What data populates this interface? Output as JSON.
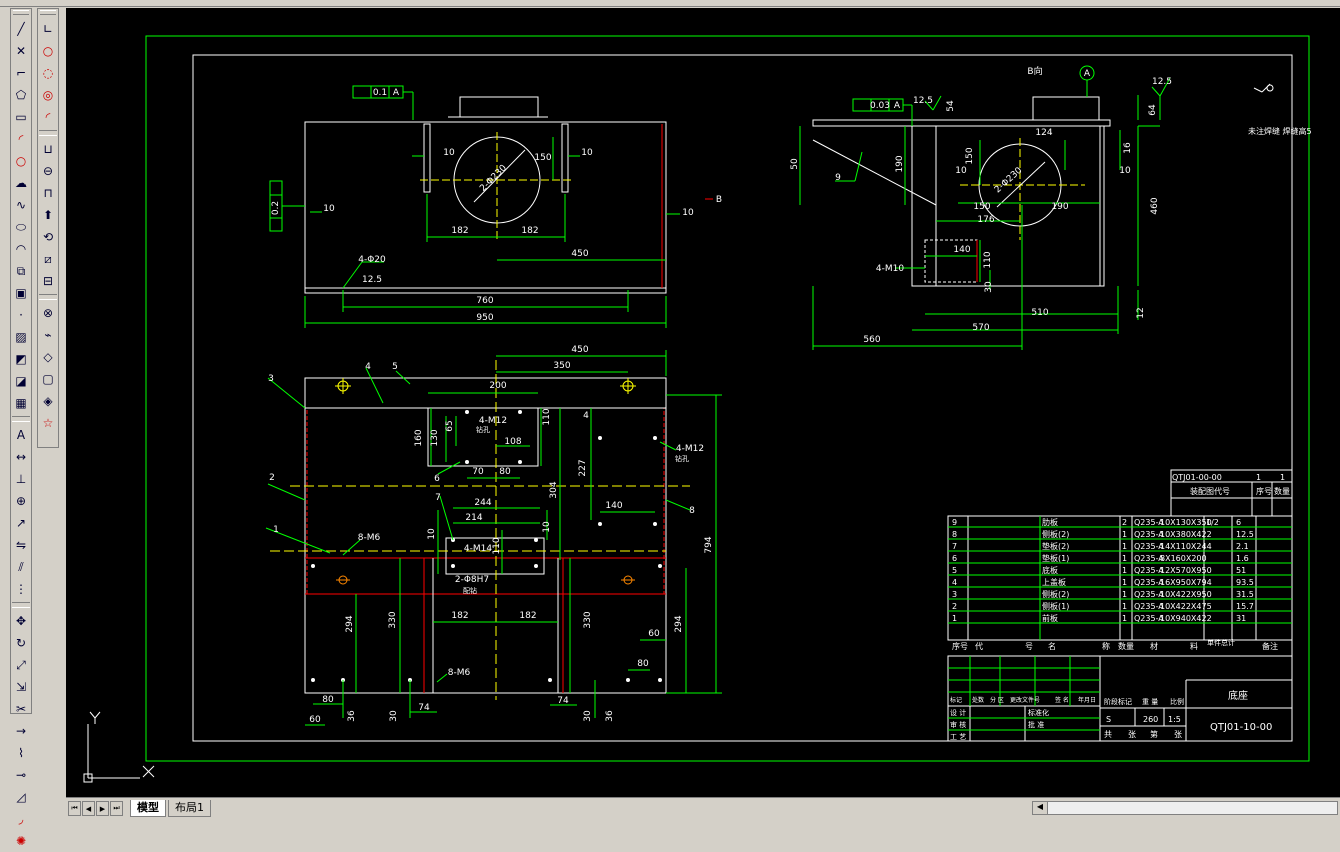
{
  "tabs": [
    {
      "label": "模型",
      "active": true
    },
    {
      "label": "布局1",
      "active": false
    }
  ],
  "toolbar_left": [
    "line-icon",
    "construction-line-icon",
    "polyline-icon",
    "polygon-icon",
    "rectangle-icon",
    "arc-icon",
    "circle-icon",
    "revcloud-icon",
    "spline-icon",
    "ellipse-icon",
    "ellipse-arc-icon",
    "insert-block-icon",
    "make-block-icon",
    "point-icon",
    "hatch-icon",
    "gradient-icon",
    "region-icon",
    "table-icon",
    "mtext-icon",
    "dimension-icon",
    "tolerance-icon",
    "center-mark-icon",
    "leader-icon",
    "mirror-icon",
    "offset-icon",
    "array-icon",
    "move-icon",
    "rotate-icon",
    "scale-icon",
    "stretch-icon",
    "trim-icon",
    "extend-icon",
    "break-icon",
    "join-icon",
    "chamfer-icon",
    "fillet-icon",
    "explode-icon"
  ],
  "toolbar_right": [
    "ucs-icon",
    "circle-icon",
    "circle-3p-icon",
    "circle-ttr-icon",
    "arc-icon",
    "union-icon",
    "subtract-icon",
    "intersect-icon",
    "extrude-icon",
    "revolve-icon",
    "slice-icon",
    "section-icon",
    "interfere-icon",
    "edge-icon",
    "face-icon",
    "shell-icon",
    "imprint-icon",
    "star-icon"
  ],
  "drawing": {
    "front_view": {
      "geom_tol": "0.1",
      "geom_tol_ref": "A",
      "perp_tol": "0.2",
      "perp_tol_ref": "A",
      "dims": {
        "d10a": "10",
        "d10b": "10",
        "d10c": "10",
        "d10d": "10",
        "d150": "150",
        "d182a": "182",
        "d182b": "182",
        "d450": "450",
        "d760": "760",
        "d950": "950",
        "d10e": "10"
      },
      "diameter": "2-Φ230",
      "holes": "4-Φ20",
      "rough": "12.5",
      "section": "B"
    },
    "side_view": {
      "parallel_tol": "0.03",
      "parallel_ref": "A",
      "rough_a": "12.5",
      "rough_b": "12.5",
      "datum": "A",
      "section": "B向",
      "dims": {
        "d54": "54",
        "d64": "64",
        "d124": "124",
        "d16": "16",
        "d50": "50",
        "d190a": "190",
        "d150a": "150",
        "d10a": "10",
        "d10b": "10",
        "d150b": "150",
        "d190b": "190",
        "d176": "176",
        "d460": "460",
        "d140": "140",
        "d110": "110",
        "d30": "30",
        "d510": "510",
        "d570": "570",
        "d560": "560",
        "d12": "12"
      },
      "diameter": "2-Φ230",
      "thread": "4-M10",
      "balloon": "9"
    },
    "note": "未注焊缝 焊缝高5",
    "plan_view": {
      "dims": {
        "d450": "450",
        "d350": "350",
        "d200": "200",
        "d110": "110",
        "d4": "4",
        "d160": "160",
        "d130": "130",
        "d65": "65",
        "d108": "108",
        "d227": "227",
        "d304": "304",
        "d70": "70",
        "d80": "80",
        "d140": "140",
        "d244": "244",
        "d214": "214",
        "d10a": "10",
        "d10b": "10",
        "d110b": "110",
        "d794": "794",
        "d330a": "330",
        "d330b": "330",
        "d182a": "182",
        "d182b": "182",
        "d294a": "294",
        "d294b": "294",
        "d60a": "60",
        "d80b": "80",
        "d80c": "80",
        "d60b": "60",
        "d36a": "36",
        "d30": "30",
        "d74a": "74",
        "d74b": "74",
        "d30b": "30",
        "d36b": "36"
      },
      "threads": {
        "t1": "4-M12",
        "t2": "4-M12",
        "t3": "8-M6",
        "t4": "4-M14",
        "t5": "8-M6"
      },
      "pin": "2-Φ8H7",
      "pin_note": "配钻",
      "thread_note_a": "钻孔",
      "thread_note_b": "钻孔",
      "balloons": [
        "1",
        "2",
        "3",
        "4",
        "5",
        "6",
        "7",
        "8"
      ]
    },
    "title_block": {
      "drawing_no_top": "QTJ01-00-00",
      "top_cells": [
        "1",
        "1"
      ],
      "top_headers": [
        "装配图代号",
        "序号",
        "数量"
      ],
      "bom": [
        {
          "no": "9",
          "name": "肋板",
          "qty": "2",
          "mat": "Q235-A",
          "spec": "10X130X350",
          "w": "1/2",
          "total": "6"
        },
        {
          "no": "8",
          "name": "侧板(2)",
          "qty": "1",
          "mat": "Q235-A",
          "spec": "10X380X422",
          "w": "",
          "total": "12.5"
        },
        {
          "no": "7",
          "name": "垫板(2)",
          "qty": "1",
          "mat": "Q235-A",
          "spec": "14X110X244",
          "w": "",
          "total": "2.1"
        },
        {
          "no": "6",
          "name": "垫板(1)",
          "qty": "1",
          "mat": "Q235-A",
          "spec": "8X160X200",
          "w": "",
          "total": "1.6"
        },
        {
          "no": "5",
          "name": "底板",
          "qty": "1",
          "mat": "Q235-A",
          "spec": "12X570X950",
          "w": "",
          "total": "51"
        },
        {
          "no": "4",
          "name": "上盖板",
          "qty": "1",
          "mat": "Q235-A",
          "spec": "16X950X794",
          "w": "",
          "total": "93.5"
        },
        {
          "no": "3",
          "name": "侧板(2)",
          "qty": "1",
          "mat": "Q235-A",
          "spec": "10X422X950",
          "w": "",
          "total": "31.5"
        },
        {
          "no": "2",
          "name": "侧板(1)",
          "qty": "1",
          "mat": "Q235-A",
          "spec": "10X422X475",
          "w": "",
          "total": "15.7"
        },
        {
          "no": "1",
          "name": "前板",
          "qty": "1",
          "mat": "Q235-A",
          "spec": "10X940X422",
          "w": "",
          "total": "31"
        }
      ],
      "header_row": [
        "序号",
        "代",
        "号",
        "名",
        "称",
        "数量",
        "材",
        "料",
        "单件总计",
        "备注"
      ],
      "part_name": "底座",
      "drawing_no": "QTJ01-10-00",
      "stage": "S",
      "weight": "260",
      "scale": "1:5",
      "footer": [
        "共",
        "张",
        "第",
        "张"
      ],
      "label_row": [
        "阶段标记",
        "重 量",
        "比例"
      ],
      "rev_headers": [
        "标记",
        "处数",
        "分 区",
        "更改文件号",
        "签 名",
        "年月日"
      ],
      "sign_rows": [
        "设 计",
        "审 核",
        "工 艺"
      ],
      "sign_rows2": [
        "标准化",
        "批 准"
      ]
    }
  }
}
